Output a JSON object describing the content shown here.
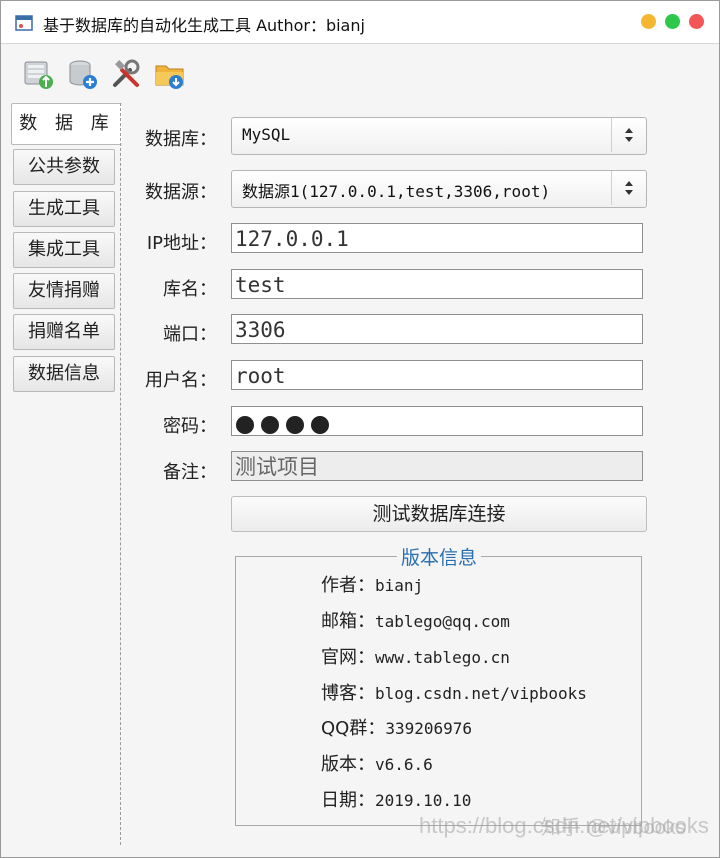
{
  "window": {
    "title": "基于数据库的自动化生成工具  Author：bianj",
    "traffic_colors": {
      "minimize": "#f5b731",
      "maximize": "#2dc84a",
      "close": "#f25656"
    }
  },
  "toolbar": {
    "icons": [
      "new-db-icon",
      "add-db-icon",
      "tools-icon",
      "open-folder-icon"
    ]
  },
  "tabs": [
    {
      "label": "数 据 库",
      "active": true
    },
    {
      "label": "公共参数",
      "active": false
    },
    {
      "label": "生成工具",
      "active": false
    },
    {
      "label": "集成工具",
      "active": false
    },
    {
      "label": "友情捐赠",
      "active": false
    },
    {
      "label": "捐赠名单",
      "active": false
    },
    {
      "label": "数据信息",
      "active": false
    }
  ],
  "form": {
    "database": {
      "label": "数据库：",
      "value": "MySQL"
    },
    "datasource": {
      "label": "数据源：",
      "value": "数据源1(127.0.0.1,test,3306,root)"
    },
    "ip": {
      "label": "IP地址：",
      "value": "127.0.0.1"
    },
    "dbname": {
      "label": "库名：",
      "value": "test"
    },
    "port": {
      "label": "端口：",
      "value": "3306"
    },
    "username": {
      "label": "用户名：",
      "value": "root"
    },
    "password": {
      "label": "密码："
    },
    "remark": {
      "label": "备注：",
      "value": "测试项目"
    },
    "test_button": "测试数据库连接"
  },
  "version_info": {
    "title": "版本信息",
    "rows": [
      {
        "key": "作者：",
        "value": "bianj"
      },
      {
        "key": "邮箱：",
        "value": "tablego@qq.com"
      },
      {
        "key": "官网：",
        "value": "www.tablego.cn"
      },
      {
        "key": "博客：",
        "value": "blog.csdn.net/vipbooks"
      },
      {
        "key": "QQ群：",
        "value": "339206976"
      },
      {
        "key": "版本：",
        "value": "v6.6.6"
      },
      {
        "key": "日期：",
        "value": "2019.10.10"
      }
    ]
  },
  "watermark": {
    "zhihu": "知乎 @vipbooks",
    "csdn": "https://blog.csdn.net/vipbooks"
  }
}
